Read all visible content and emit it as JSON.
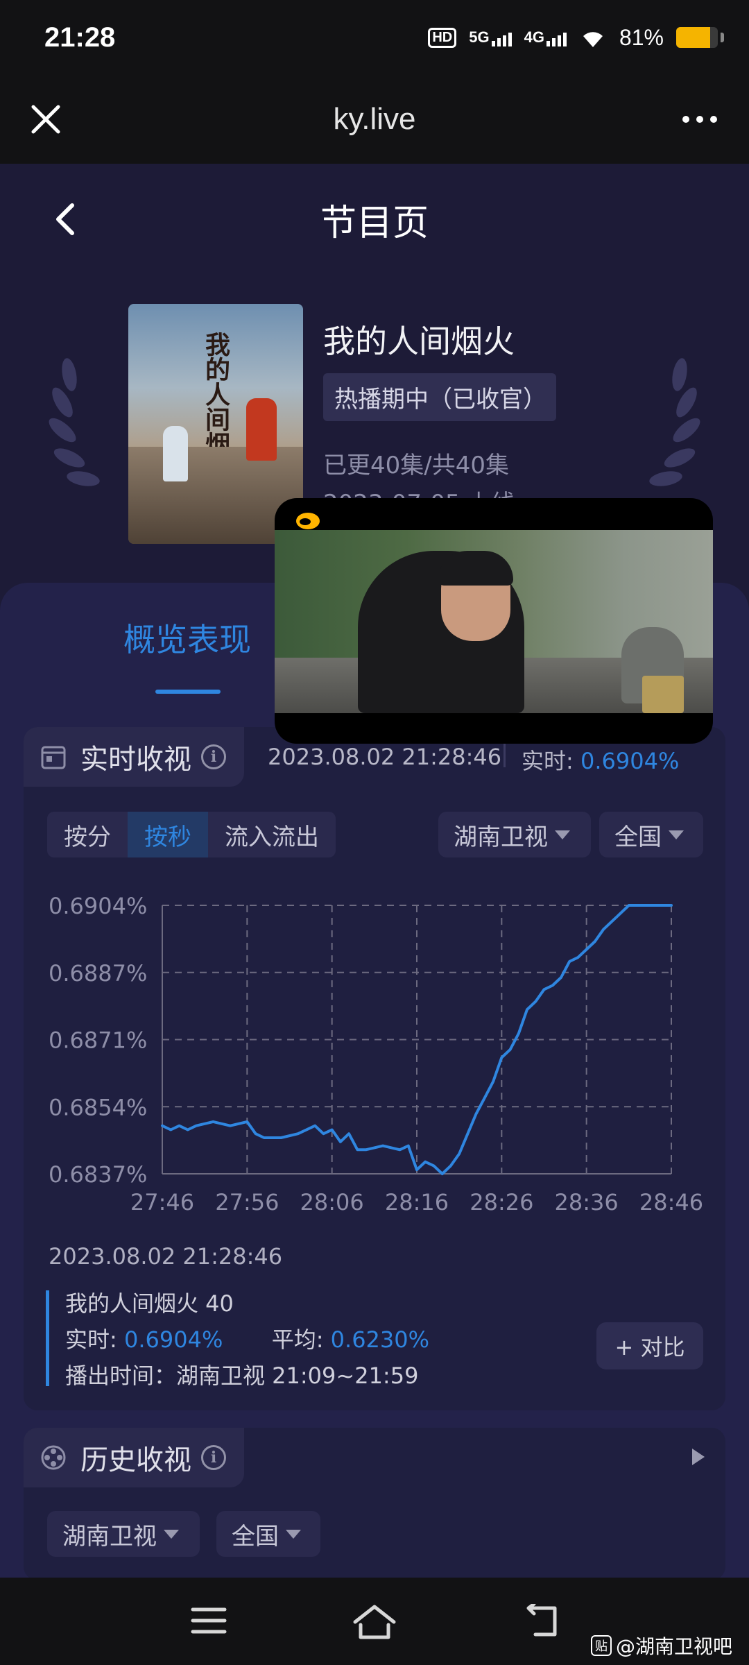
{
  "status_bar": {
    "time": "21:28",
    "hd": "HD",
    "net1": "5G",
    "net2": "4G",
    "battery": "81%",
    "battery_level": 0.81
  },
  "browser": {
    "title": "ky.live"
  },
  "page": {
    "title": "节目页"
  },
  "show": {
    "title": "我的人间烟火",
    "status": "热播期中（已收官）",
    "episodes": "已更40集/共40集",
    "air_date": "2023-07-05 上线",
    "poster_title": "我的人间烟火"
  },
  "tabs": {
    "overview": "概览表现"
  },
  "realtime": {
    "heading": "实时收视",
    "timestamp": "2023.08.02 21:28:46",
    "label": "实时:",
    "value": "0.6904%",
    "segments": [
      "按分",
      "按秒",
      "流入流出"
    ],
    "active_segment": 1,
    "channel": "湖南卫视",
    "region": "全国"
  },
  "chart_data": {
    "type": "line",
    "title": "",
    "xlabel": "",
    "ylabel": "",
    "x_ticks": [
      "27:46",
      "27:56",
      "28:06",
      "28:16",
      "28:26",
      "28:36",
      "28:46"
    ],
    "y_ticks": [
      "0.6904%",
      "0.6887%",
      "0.6871%",
      "0.6854%",
      "0.6837%"
    ],
    "ylim": [
      0.6837,
      0.6904
    ],
    "grid": true,
    "line_color": "#2f86e0",
    "series": [
      {
        "x": [
          "27:46",
          "27:47",
          "27:48",
          "27:49",
          "27:50",
          "27:52",
          "27:54",
          "27:56",
          "27:57",
          "27:58",
          "28:00",
          "28:02",
          "28:04",
          "28:05",
          "28:06",
          "28:07",
          "28:08",
          "28:09",
          "28:10",
          "28:12",
          "28:14",
          "28:15",
          "28:16",
          "28:17",
          "28:18",
          "28:19",
          "28:20",
          "28:21",
          "28:22",
          "28:23",
          "28:24",
          "28:25",
          "28:26",
          "28:27",
          "28:28",
          "28:29",
          "28:30",
          "28:31",
          "28:32",
          "28:33",
          "28:34",
          "28:35",
          "28:36",
          "28:37",
          "28:38",
          "28:39",
          "28:40",
          "28:41",
          "28:42",
          "28:43",
          "28:44",
          "28:45",
          "28:46"
        ],
        "values": [
          0.6849,
          0.6848,
          0.6849,
          0.6848,
          0.6849,
          0.685,
          0.6849,
          0.685,
          0.6847,
          0.6846,
          0.6846,
          0.6847,
          0.6849,
          0.6847,
          0.6848,
          0.6845,
          0.6847,
          0.6843,
          0.6843,
          0.6844,
          0.6843,
          0.6844,
          0.6838,
          0.684,
          0.6839,
          0.6837,
          0.6839,
          0.6842,
          0.6847,
          0.6852,
          0.6856,
          0.686,
          0.6866,
          0.6868,
          0.6872,
          0.6878,
          0.688,
          0.6883,
          0.6884,
          0.6886,
          0.689,
          0.6891,
          0.6893,
          0.6895,
          0.6898,
          0.69,
          0.6902,
          0.6904,
          0.6904,
          0.6904,
          0.6904,
          0.6904,
          0.6904
        ]
      }
    ]
  },
  "detail": {
    "timestamp": "2023.08.02 21:28:46",
    "name": "我的人间烟火 40",
    "realtime_label": "实时:",
    "realtime_value": "0.6904%",
    "avg_label": "平均:",
    "avg_value": "0.6230%",
    "air_time": "播出时间：湖南卫视 21:09~21:59",
    "compare": "+ 对比"
  },
  "history": {
    "heading": "历史收视",
    "channel": "湖南卫视",
    "region": "全国"
  },
  "watermark": {
    "badge": "贴",
    "text": "@湖南卫视吧"
  }
}
